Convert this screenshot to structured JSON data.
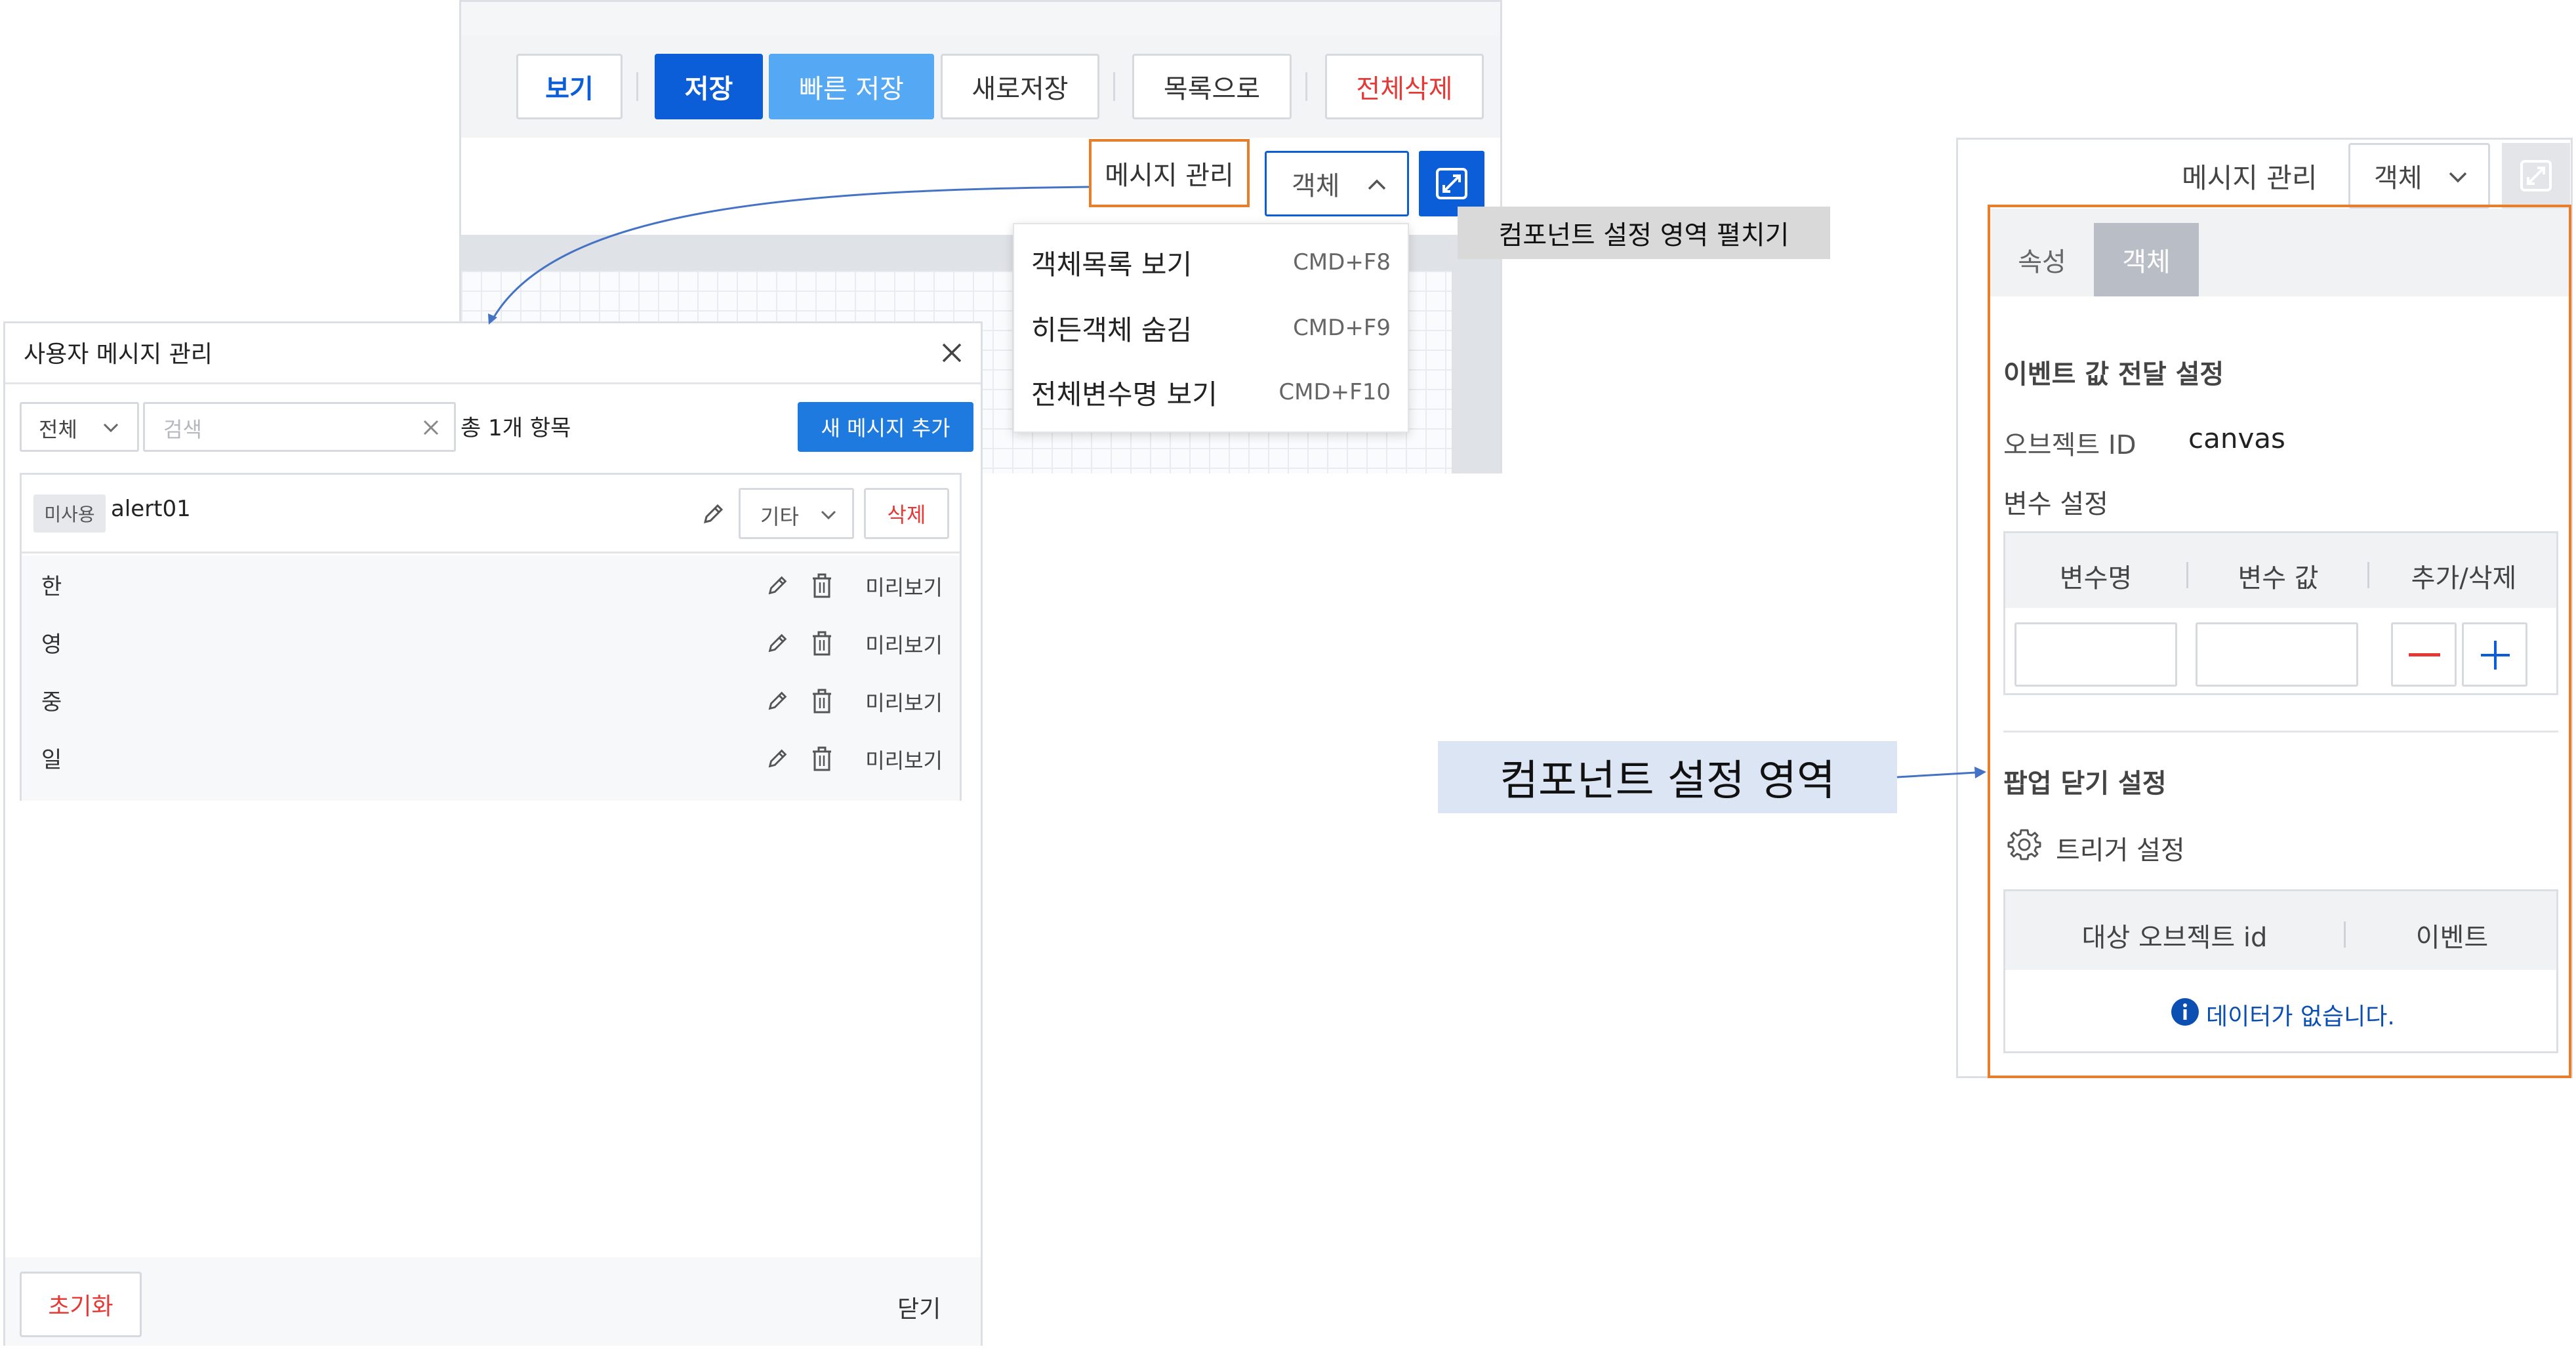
{
  "toolbar": {
    "view_label": "보기",
    "save_label": "저장",
    "quick_save_label": "빠른 저장",
    "save_new_label": "새로저장",
    "to_list_label": "목록으로",
    "delete_all_label": "전체삭제",
    "message_manage_label": "메시지 관리",
    "object_dropdown_label": "객체",
    "expand_icon": "expand-icon"
  },
  "object_menu": {
    "items": [
      {
        "label": "객체목록 보기",
        "shortcut": "CMD+F8"
      },
      {
        "label": "히든객체 숨김",
        "shortcut": "CMD+F9"
      },
      {
        "label": "전체변수명 보기",
        "shortcut": "CMD+F10"
      }
    ]
  },
  "callouts": {
    "expand_tooltip": "컴포넌트 설정 영역 펼치기",
    "component_area_label": "컴포넌트 설정 영역"
  },
  "message_dialog": {
    "title": "사용자 메시지 관리",
    "filter_value": "전체",
    "search_placeholder": "검색",
    "total_count": "총 1개 항목",
    "add_button": "새 메시지 추가",
    "message": {
      "status_badge": "미사용",
      "id": "alert01",
      "category": "기타",
      "delete_label": "삭제"
    },
    "languages": [
      {
        "label": "한",
        "preview": "미리보기"
      },
      {
        "label": "영",
        "preview": "미리보기"
      },
      {
        "label": "중",
        "preview": "미리보기"
      },
      {
        "label": "일",
        "preview": "미리보기"
      }
    ],
    "reset_label": "초기화",
    "close_label": "닫기"
  },
  "right_panel": {
    "message_manage_label": "메시지 관리",
    "object_dropdown_label": "객체",
    "tabs": [
      {
        "label": "속성"
      },
      {
        "label": "객체"
      }
    ],
    "event_section_title": "이벤트 값 전달 설정",
    "object_id_label": "오브젝트 ID",
    "object_id_value": "canvas",
    "variable_section_title": "변수 설정",
    "variable_headers": [
      "변수명",
      "변수 값",
      "추가/삭제"
    ],
    "popup_close_title": "팝업 닫기 설정",
    "trigger_label": "트리거 설정",
    "trigger_headers": [
      "대상 오브젝트 id",
      "이벤트"
    ],
    "empty_message": "데이터가 없습니다."
  },
  "colors": {
    "primary": "#0b5ed7",
    "light_blue": "#55a9f4",
    "danger": "#e53935",
    "highlight_orange": "#e87d2a",
    "callout_gray": "#d9d9d9",
    "callout_blue": "#dbe5f3",
    "connector_blue": "#4472c4"
  }
}
